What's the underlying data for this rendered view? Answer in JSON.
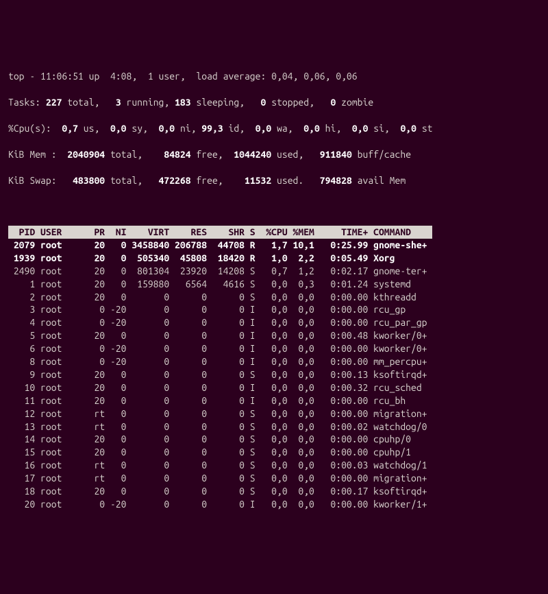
{
  "summary": {
    "line1_a": "top - 11:06:51 up  4:08,  1 user,  load average: 0,04, 0,06, 0,06",
    "tasks_label": "Tasks:",
    "tasks_total": " 227 ",
    "tasks_total_l": "total,",
    "tasks_run": "   3 ",
    "tasks_run_l": "running,",
    "tasks_sleep": " 183 ",
    "tasks_sleep_l": "sleeping,",
    "tasks_stop": "   0 ",
    "tasks_stop_l": "stopped,",
    "tasks_zom": "   0 ",
    "tasks_zom_l": "zombie",
    "cpu_label": "%Cpu(s):",
    "cpu_us": "  0,7 ",
    "cpu_us_l": "us,",
    "cpu_sy": "  0,0 ",
    "cpu_sy_l": "sy,",
    "cpu_ni": "  0,0 ",
    "cpu_ni_l": "ni,",
    "cpu_id": " 99,3 ",
    "cpu_id_l": "id,",
    "cpu_wa": "  0,0 ",
    "cpu_wa_l": "wa,",
    "cpu_hi": "  0,0 ",
    "cpu_hi_l": "hi,",
    "cpu_si": "  0,0 ",
    "cpu_si_l": "si,",
    "cpu_st": "  0,0 ",
    "cpu_st_l": "st",
    "mem_label": "KiB Mem :",
    "mem_total": "  2040904 ",
    "mem_total_l": "total,",
    "mem_free": "    84824 ",
    "mem_free_l": "free,",
    "mem_used": "  1044240 ",
    "mem_used_l": "used,",
    "mem_buff": "   911840 ",
    "mem_buff_l": "buff/cache",
    "swap_label": "KiB Swap:",
    "swap_total": "   483800 ",
    "swap_total_l": "total,",
    "swap_free": "   472268 ",
    "swap_free_l": "free,",
    "swap_used": "    11532 ",
    "swap_used_l": "used.",
    "swap_avail": "   794828 ",
    "swap_avail_l": "avail Mem"
  },
  "columns": "  PID USER      PR  NI    VIRT    RES    SHR S  %CPU %MEM     TIME+ COMMAND    ",
  "rows": [
    {
      "bold": true,
      "text": " 2079 root      20   0 3458840 206788  44708 R   1,7 10,1   0:25.99 gnome-she+"
    },
    {
      "bold": true,
      "text": " 1939 root      20   0  505340  45808  18420 R   1,0  2,2   0:05.49 Xorg"
    },
    {
      "bold": false,
      "text": " 2490 root      20   0  801304  23920  14208 S   0,7  1,2   0:02.17 gnome-ter+"
    },
    {
      "bold": false,
      "text": "    1 root      20   0  159880   6564   4616 S   0,0  0,3   0:01.24 systemd"
    },
    {
      "bold": false,
      "text": "    2 root      20   0       0      0      0 S   0,0  0,0   0:00.00 kthreadd"
    },
    {
      "bold": false,
      "text": "    3 root       0 -20       0      0      0 I   0,0  0,0   0:00.00 rcu_gp"
    },
    {
      "bold": false,
      "text": "    4 root       0 -20       0      0      0 I   0,0  0,0   0:00.00 rcu_par_gp"
    },
    {
      "bold": false,
      "text": "    5 root      20   0       0      0      0 I   0,0  0,0   0:00.48 kworker/0+"
    },
    {
      "bold": false,
      "text": "    6 root       0 -20       0      0      0 I   0,0  0,0   0:00.00 kworker/0+"
    },
    {
      "bold": false,
      "text": "    8 root       0 -20       0      0      0 I   0,0  0,0   0:00.00 mm_percpu+"
    },
    {
      "bold": false,
      "text": "    9 root      20   0       0      0      0 S   0,0  0,0   0:00.13 ksoftirqd+"
    },
    {
      "bold": false,
      "text": "   10 root      20   0       0      0      0 I   0,0  0,0   0:00.32 rcu_sched"
    },
    {
      "bold": false,
      "text": "   11 root      20   0       0      0      0 I   0,0  0,0   0:00.00 rcu_bh"
    },
    {
      "bold": false,
      "text": "   12 root      rt   0       0      0      0 S   0,0  0,0   0:00.00 migration+"
    },
    {
      "bold": false,
      "text": "   13 root      rt   0       0      0      0 S   0,0  0,0   0:00.02 watchdog/0"
    },
    {
      "bold": false,
      "text": "   14 root      20   0       0      0      0 S   0,0  0,0   0:00.00 cpuhp/0"
    },
    {
      "bold": false,
      "text": "   15 root      20   0       0      0      0 S   0,0  0,0   0:00.00 cpuhp/1"
    },
    {
      "bold": false,
      "text": "   16 root      rt   0       0      0      0 S   0,0  0,0   0:00.03 watchdog/1"
    },
    {
      "bold": false,
      "text": "   17 root      rt   0       0      0      0 S   0,0  0,0   0:00.00 migration+"
    },
    {
      "bold": false,
      "text": "   18 root      20   0       0      0      0 S   0,0  0,0   0:00.17 ksoftirqd+"
    },
    {
      "bold": false,
      "text": "   20 root       0 -20       0      0      0 I   0,0  0,0   0:00.00 kworker/1+"
    }
  ]
}
